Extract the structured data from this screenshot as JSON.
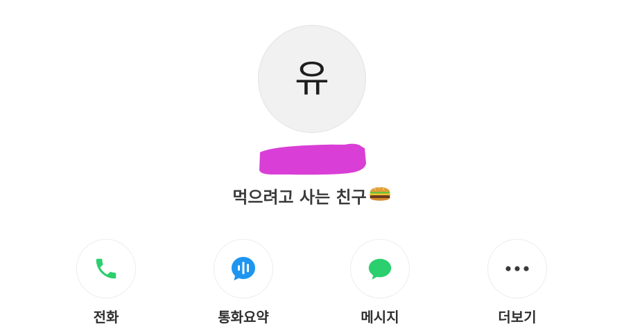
{
  "profile": {
    "avatar_initial": "유",
    "status_message": "먹으려고 사는 친구"
  },
  "actions": [
    {
      "label": "전화",
      "icon": "phone-icon",
      "color": "#2bcf6e"
    },
    {
      "label": "통화요약",
      "icon": "audio-summary-icon",
      "color": "#1e96f0"
    },
    {
      "label": "메시지",
      "icon": "chat-bubble-icon",
      "color": "#2bcf6e"
    },
    {
      "label": "더보기",
      "icon": "more-dots-icon",
      "color": "#3a3a3a"
    }
  ],
  "colors": {
    "redaction": "#d93fd6",
    "green": "#2bcf6e",
    "blue": "#1e96f0"
  }
}
